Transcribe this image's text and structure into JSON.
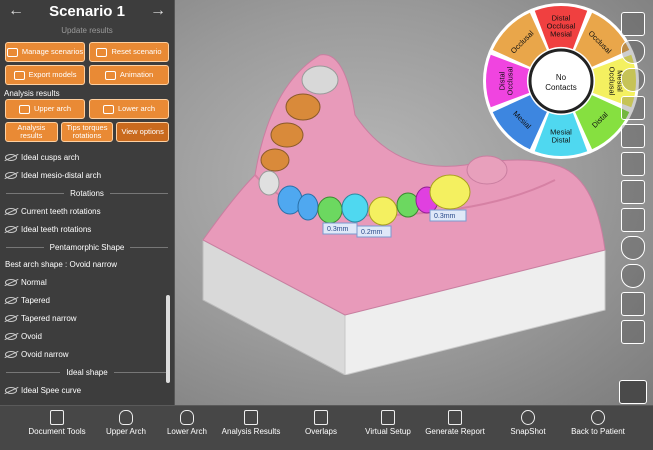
{
  "header": {
    "title": "Scenario 1",
    "update_label": "Update results"
  },
  "buttons": {
    "manage": "Manage scenarios",
    "reset": "Reset scenario",
    "export": "Export models",
    "animation": "Animation"
  },
  "analysis": {
    "section_label": "Analysis results",
    "upper_arch": "Upper arch",
    "lower_arch": "Lower arch",
    "analysis_results": "Analysis results",
    "tips_torques": "Tips torques rotations",
    "view_options": "View options"
  },
  "list": {
    "ideal_cusps": "Ideal cusps arch",
    "ideal_mesio": "Ideal mesio-distal arch",
    "rotations_title": "Rotations",
    "current_rotations": "Current teeth rotations",
    "ideal_rotations": "Ideal teeth rotations",
    "pentamorphic_title": "Pentamorphic Shape",
    "best_arch": "Best arch shape : Ovoid narrow",
    "normal": "Normal",
    "tapered": "Tapered",
    "tapered_narrow": "Tapered narrow",
    "ovoid": "Ovoid",
    "ovoid_narrow": "Ovoid narrow",
    "ideal_shape_title": "Ideal shape",
    "ideal_spee": "Ideal Spee curve"
  },
  "wheel": {
    "center": "No Contacts",
    "segments": [
      {
        "label": "Distal Occlusal Mesial",
        "color": "#f04040"
      },
      {
        "label": "Occlusal",
        "color": "#e9a64a"
      },
      {
        "label": "Mesial Occlusal",
        "color": "#f4f060"
      },
      {
        "label": "Distal",
        "color": "#86e040"
      },
      {
        "label": "Mesial Distal",
        "color": "#4fd8f0"
      },
      {
        "label": "Mesial",
        "color": "#3d86e0"
      },
      {
        "label": "Distal Occlusal",
        "color": "#f044e0"
      },
      {
        "label": "Occlusal",
        "color": "#e9a64a"
      }
    ]
  },
  "measurements": [
    "0.3mm",
    "0.2mm",
    "0.3mm",
    "0.3mm"
  ],
  "bottom": {
    "document_tools": "Document Tools",
    "upper_arch": "Upper Arch",
    "lower_arch": "Lower Arch",
    "analysis_results": "Analysis Results",
    "overlaps": "Overlaps",
    "virtual_setup": "Virtual Setup",
    "generate_report": "Generate Report",
    "snapshot": "SnapShot",
    "back_to_patient": "Back to Patient"
  },
  "colors": {
    "accent": "#e98a35",
    "panel": "#3d3d3d",
    "gum": "#e89aba"
  }
}
